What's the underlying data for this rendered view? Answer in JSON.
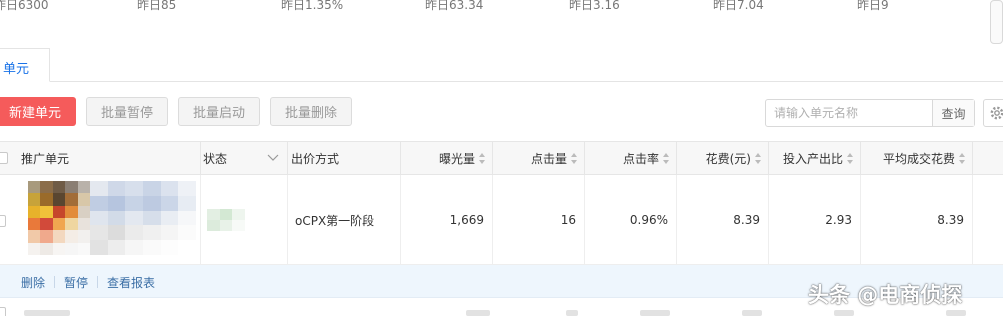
{
  "stats": [
    "昨日6300",
    "昨日85",
    "昨日1.35%",
    "昨日63.34",
    "昨日3.16",
    "昨日7.04",
    "昨日9"
  ],
  "tabs": {
    "active": "单元"
  },
  "toolbar": {
    "new_unit": "新建单元",
    "batch_pause": "批量暂停",
    "batch_start": "批量启动",
    "batch_delete": "批量删除"
  },
  "search": {
    "placeholder": "请输入单元名称",
    "button": "查询",
    "value": ""
  },
  "table": {
    "headers": {
      "unit": "推广单元",
      "status": "状态",
      "bid_method": "出价方式",
      "impressions": "曝光量",
      "clicks": "点击量",
      "ctr": "点击率",
      "cost": "花费(元)",
      "roi": "投入产出比",
      "avg_cost": "平均成交花费"
    },
    "rows": [
      {
        "bid_method": "oCPX第一阶段",
        "impressions": "1,669",
        "clicks": "16",
        "ctr": "0.96%",
        "cost": "8.39",
        "roi": "2.93",
        "avg_cost": "8.39"
      }
    ],
    "row_actions": [
      "删除",
      "暂停",
      "查看报表"
    ]
  },
  "watermark": "头条 @电商侦探",
  "colors": {
    "primary": "#f55b5b",
    "link": "#3a6ea5",
    "tab_active": "#1a73e8",
    "action_bg": "#eef6fd"
  }
}
